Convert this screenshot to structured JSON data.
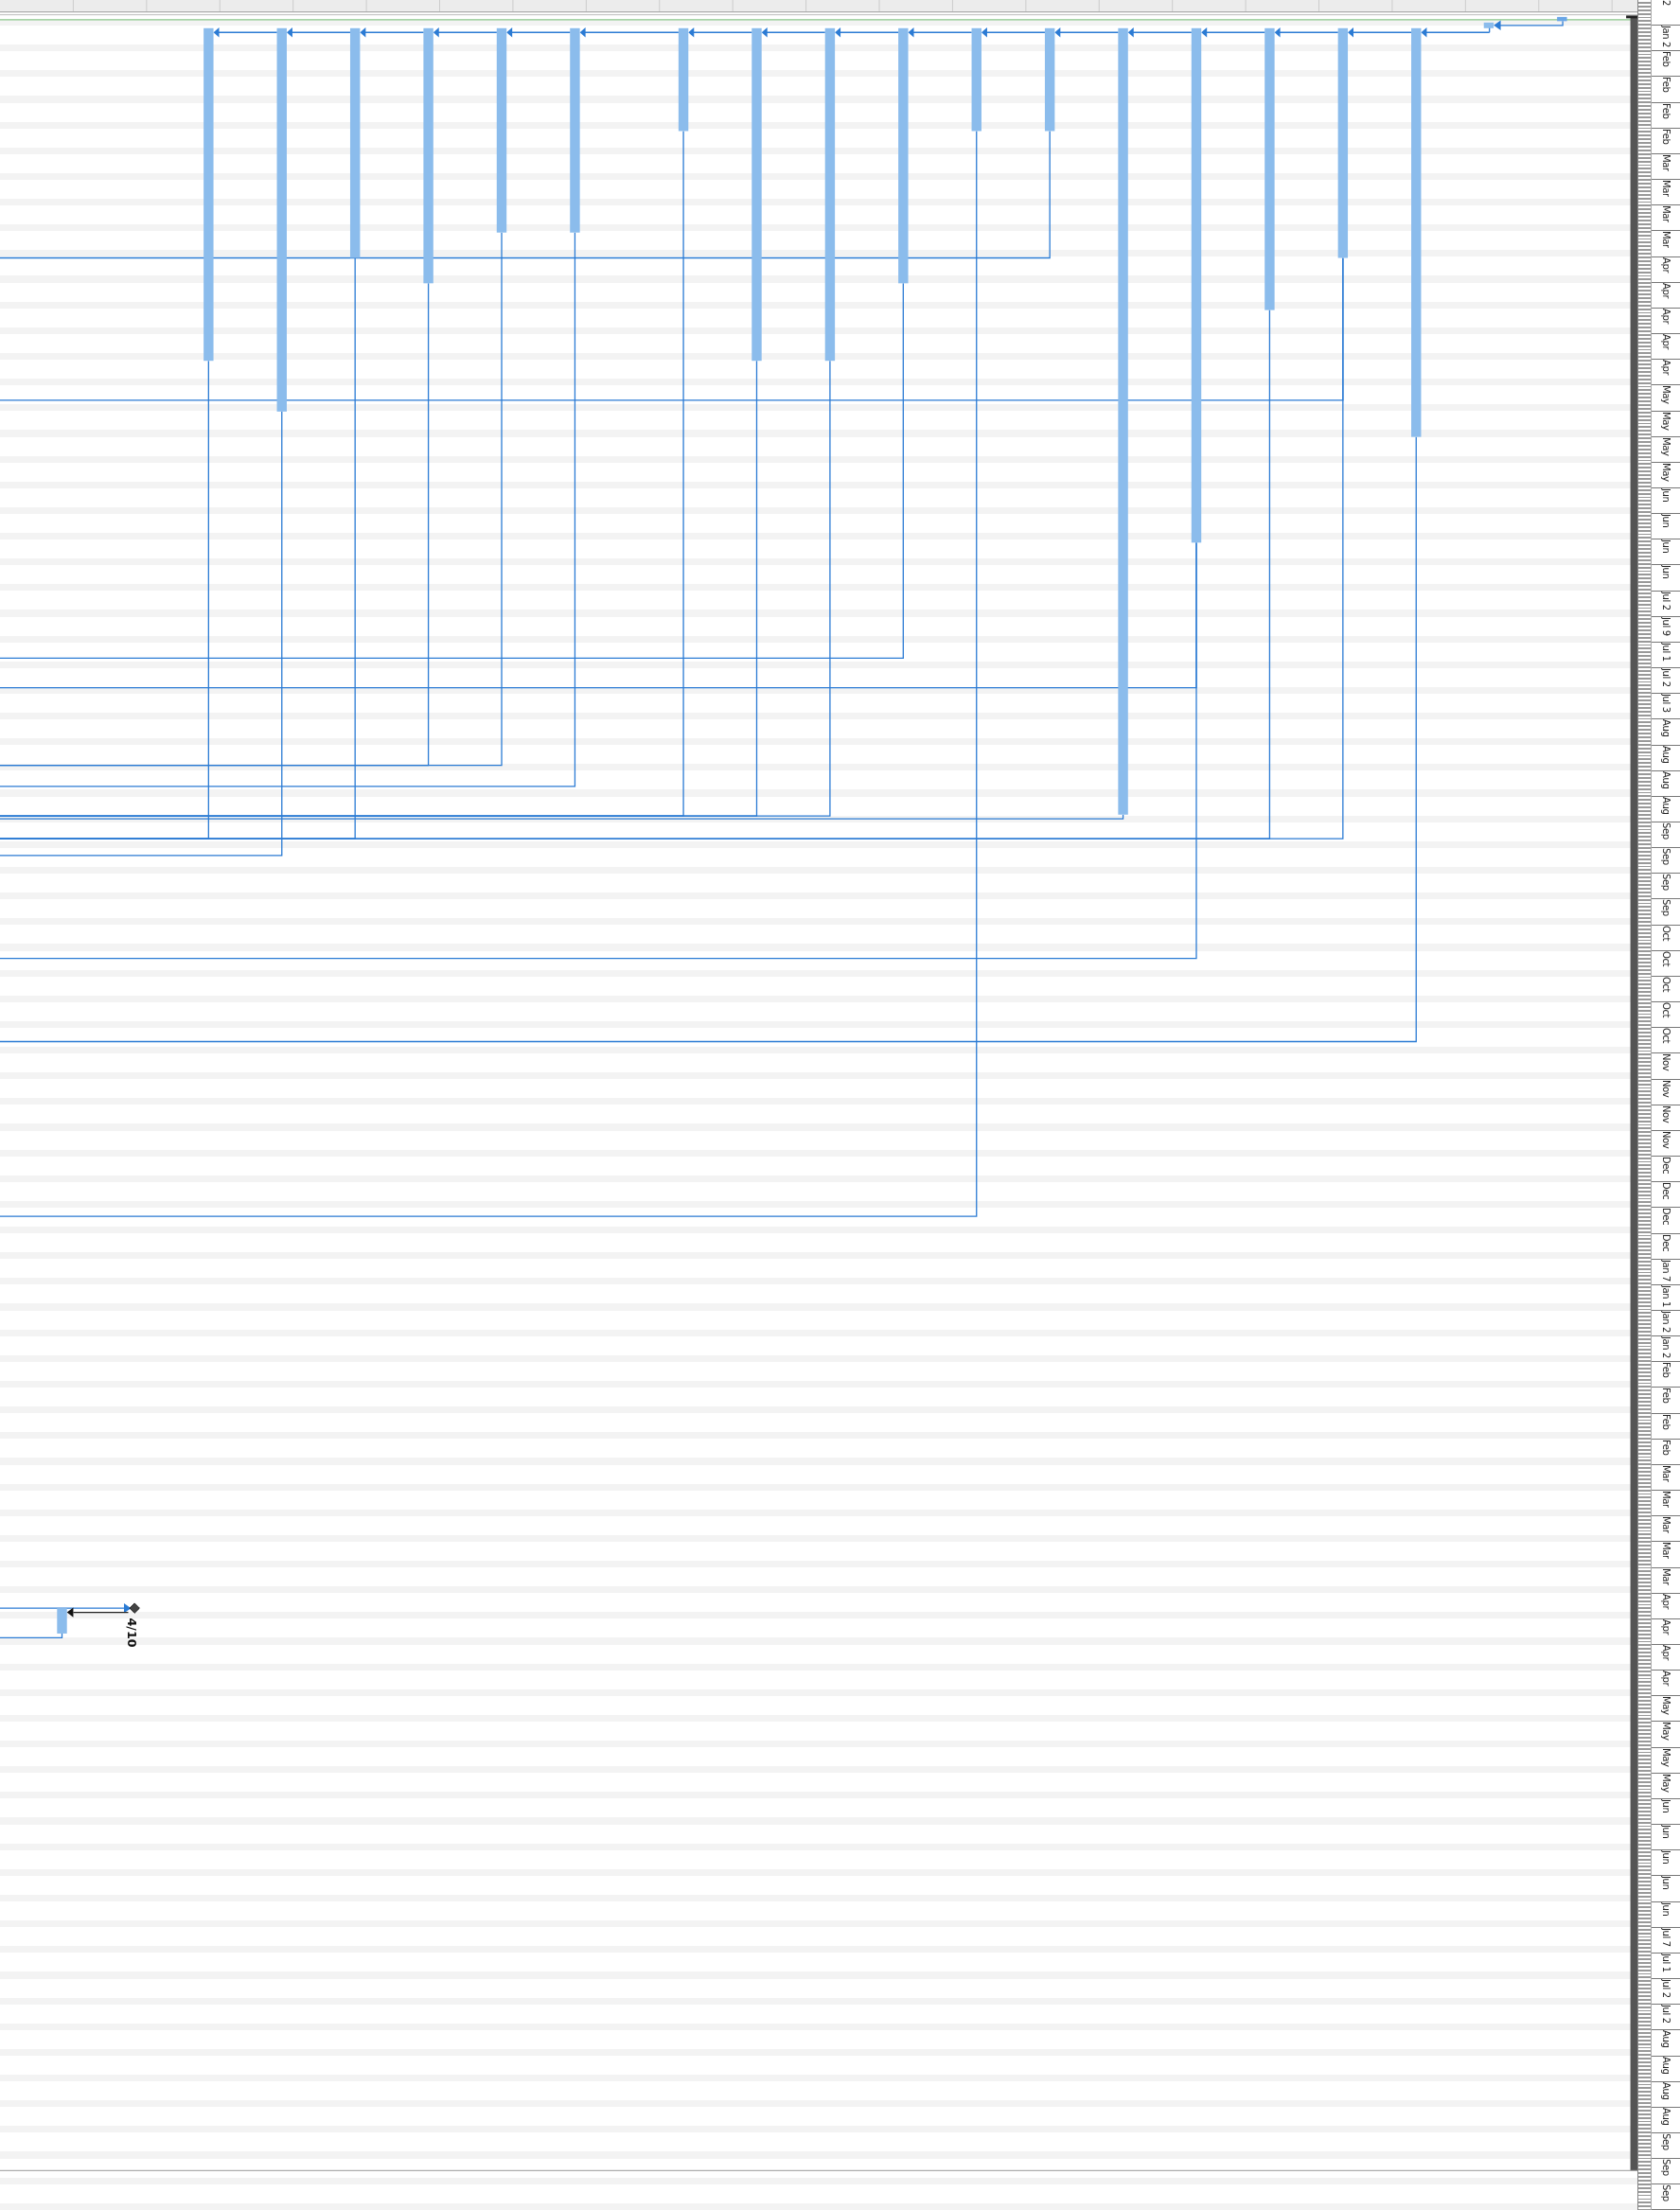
{
  "timescale": {
    "labels": [
      "2",
      "Jan 2",
      "Feb",
      "Feb",
      "Feb",
      "Feb",
      "Mar",
      "Mar",
      "Mar",
      "Mar",
      "Apr",
      "Apr",
      "Apr",
      "Apr",
      "Apr",
      "May",
      "May",
      "May",
      "May",
      "Jun",
      "Jun",
      "Jun",
      "Jun",
      "Jul 2",
      "Jul 9",
      "Jul 1",
      "Jul 2",
      "Jul 3",
      "Aug",
      "Aug",
      "Aug",
      "Aug",
      "Sep",
      "Sep",
      "Sep",
      "Sep",
      "Oct",
      "Oct",
      "Oct",
      "Oct",
      "Oct",
      "Nov",
      "Nov",
      "Nov",
      "Nov",
      "Dec",
      "Dec",
      "Dec",
      "Dec",
      "Jan 7",
      "Jan 1",
      "Jan 2",
      "Jan 2",
      "Feb",
      "Feb",
      "Feb",
      "Feb",
      "Mar",
      "Mar",
      "Mar",
      "Mar",
      "Mar",
      "Apr",
      "Apr",
      "Apr",
      "Apr",
      "May",
      "May",
      "May",
      "May",
      "Jun",
      "Jun",
      "Jun",
      "Jun",
      "Jun",
      "Jul 7",
      "Jul 1",
      "Jul 2",
      "Jul 2",
      "Aug",
      "Aug",
      "Aug",
      "Aug",
      "Sep",
      "Sep",
      "Sep"
    ]
  },
  "milestone": {
    "label": "4/10"
  }
}
